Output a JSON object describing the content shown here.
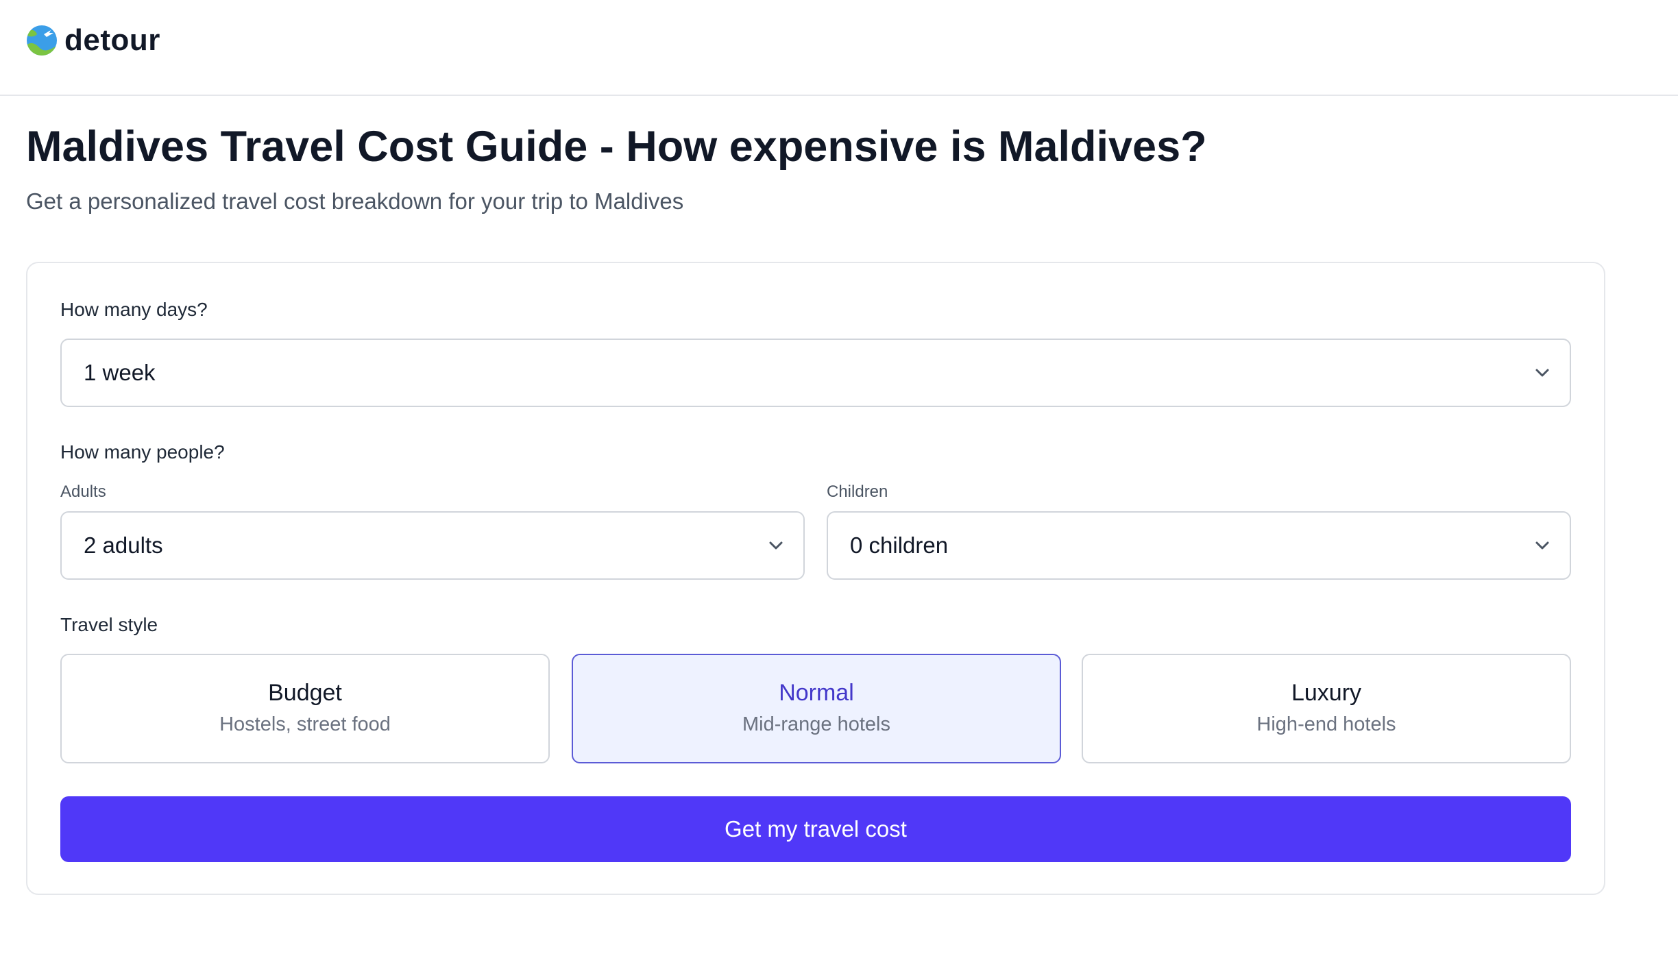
{
  "header": {
    "brand": "detour",
    "logo_icon": "globe-icon"
  },
  "page": {
    "title": "Maldives Travel Cost Guide - How expensive is Maldives?",
    "subtitle": "Get a personalized travel cost breakdown for your trip to Maldives"
  },
  "form": {
    "days": {
      "label": "How many days?",
      "value": "1 week"
    },
    "people": {
      "label": "How many people?",
      "adults": {
        "label": "Adults",
        "value": "2 adults"
      },
      "children": {
        "label": "Children",
        "value": "0 children"
      }
    },
    "travel_style": {
      "label": "Travel style",
      "selected": "Normal",
      "options": [
        {
          "name": "Budget",
          "desc": "Hostels, street food"
        },
        {
          "name": "Normal",
          "desc": "Mid-range hotels"
        },
        {
          "name": "Luxury",
          "desc": "High-end hotels"
        }
      ]
    },
    "submit_label": "Get my travel cost"
  },
  "colors": {
    "primary": "#5038f8",
    "selected_bg": "#eef2ff",
    "selected_border": "#5b5bd6",
    "selected_text": "#4338ca"
  }
}
